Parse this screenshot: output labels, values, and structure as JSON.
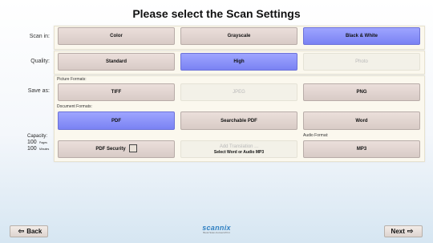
{
  "title": "Please select the Scan Settings",
  "rows": {
    "scan_in": "Scan in:",
    "quality": "Quality:",
    "save_as": "Save as:"
  },
  "scan_in": {
    "color": "Color",
    "grayscale": "Grayscale",
    "bw": "Black & White"
  },
  "quality": {
    "standard": "Standard",
    "high": "High",
    "photo": "Photo"
  },
  "save_as": {
    "picture_formats": "Picture Formats:",
    "tiff": "TIFF",
    "jpeg": "JPEG",
    "png": "PNG",
    "document_formats": "Document Formats:",
    "pdf": "PDF",
    "searchable_pdf": "Searchable PDF",
    "word": "Word",
    "pdf_security": "PDF Security",
    "add_translation": "Add Translation ...",
    "add_translation_sub": "Select Word or Audio MP3",
    "audio_format": "Audio Format:",
    "mp3": "MP3"
  },
  "capacity": {
    "label": "Capacity:",
    "pages_value": "100",
    "pages_unit": "Pages",
    "minutes_value": "100",
    "minutes_unit": "Minutes"
  },
  "nav": {
    "back": "Back",
    "next": "Next"
  },
  "logo": {
    "brand": "scannix",
    "tag": "Book Scan-Convert-Print"
  },
  "colors": {
    "selected": "#8a91fa",
    "panel": "#fbf8ee",
    "button": "#e2d6d1"
  }
}
